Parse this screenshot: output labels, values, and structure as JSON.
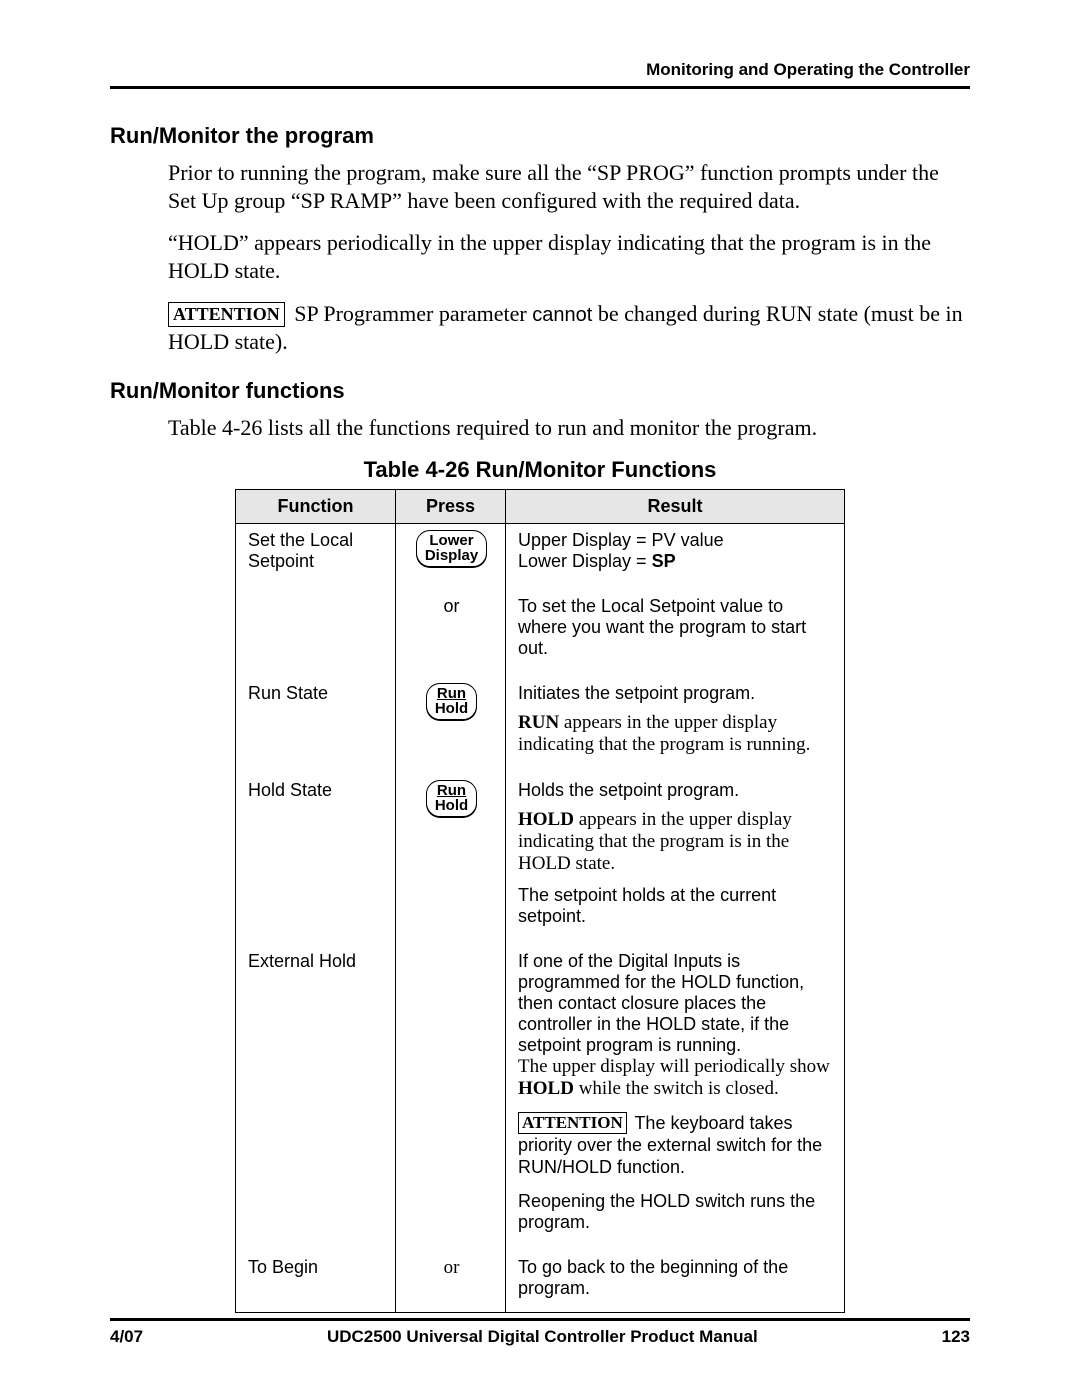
{
  "header": {
    "running": "Monitoring and Operating the Controller"
  },
  "section1": {
    "title": "Run/Monitor the program",
    "p1": "Prior to running the program, make sure all the “SP PROG” function prompts under the Set Up group “SP RAMP” have been configured with the required data.",
    "p2": "“HOLD” appears periodically in the upper display indicating that the program is in the HOLD state.",
    "att_label": "ATTENTION",
    "att_pre": "SP Programmer parameter ",
    "att_em": "cannot",
    "att_post": " be changed during RUN state (must be in HOLD state)."
  },
  "section2": {
    "title": "Run/Monitor functions",
    "p1": "Table 4-26 lists all the functions required to run and monitor the program."
  },
  "table": {
    "caption": "Table 4-26  Run/Monitor Functions",
    "head": {
      "c1": "Function",
      "c2": "Press",
      "c3": "Result"
    },
    "rows": {
      "r0": {
        "fn": "Set the Local Setpoint",
        "key_l1": "Lower",
        "key_l2": "Display",
        "res_a": "Upper Display = PV value",
        "res_b_pre": "Lower Display = ",
        "res_b_b": "SP"
      },
      "r1": {
        "or": "or",
        "res": "To set the Local Setpoint value to where you want the program to start out."
      },
      "r2": {
        "fn": "Run State",
        "key_l1": "Run",
        "key_l2": "Hold",
        "res_a": "Initiates the setpoint program.",
        "res_b_b": "RUN",
        "res_b_post": "  appears in the upper display indicating that the program is running."
      },
      "r3": {
        "fn": "Hold State",
        "key_l1": "Run",
        "key_l2": "Hold",
        "res_a": "Holds the setpoint program.",
        "res_b_b": "HOLD",
        "res_b_post": "  appears in the upper display indicating that the program is in the HOLD state.",
        "res_c": "The setpoint holds at the current setpoint."
      },
      "r4": {
        "fn": "External Hold",
        "res_a": "If one of the Digital Inputs is programmed for the HOLD function, then contact closure places the controller in the HOLD state, if the setpoint program is running.",
        "res_b_pre": "The upper display will periodically show ",
        "res_b_b": "HOLD",
        "res_b_post": "  while the switch is closed.",
        "att_label": "ATTENTION",
        "res_c": "  The keyboard takes priority over the external switch for the RUN/HOLD function.",
        "res_d": "Reopening the HOLD switch runs the program."
      },
      "r5": {
        "fn": "To Begin",
        "or": "or",
        "res": "To go back to the beginning of the program."
      }
    }
  },
  "footer": {
    "date": "4/07",
    "title": "UDC2500 Universal Digital Controller Product Manual",
    "page": "123"
  }
}
